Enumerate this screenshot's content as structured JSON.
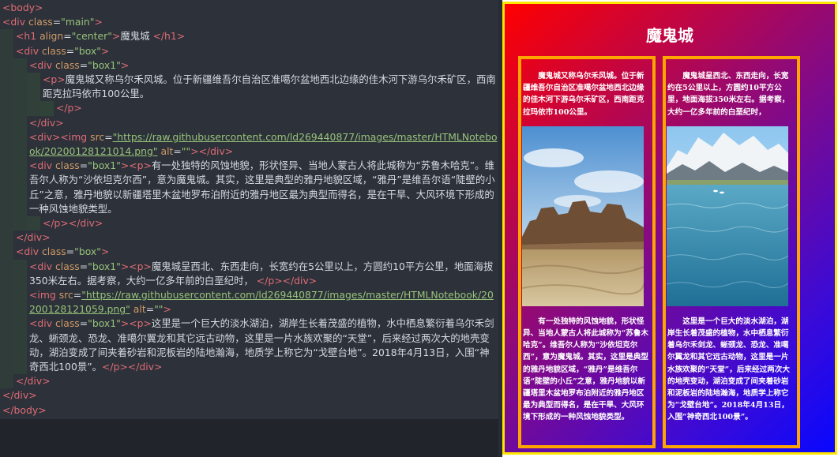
{
  "editor": {
    "lines": [
      {
        "i": 0,
        "p": [
          [
            "tk",
            "<body>"
          ]
        ]
      },
      {
        "i": 0,
        "p": [
          [
            "tk",
            "<div "
          ],
          [
            "at",
            "class"
          ],
          [
            "tx",
            "="
          ],
          [
            "sv",
            "\"main\""
          ],
          [
            "tk",
            ">"
          ]
        ]
      },
      {
        "i": 1,
        "p": [
          [
            "tk",
            "<h1 "
          ],
          [
            "at",
            "align"
          ],
          [
            "tx",
            "="
          ],
          [
            "sv",
            "\"center\""
          ],
          [
            "tk",
            ">"
          ],
          [
            "tx",
            "魔鬼城 "
          ],
          [
            "tk",
            "</h1>"
          ]
        ]
      },
      {
        "i": 1,
        "p": [
          [
            "tk",
            "<div "
          ],
          [
            "at",
            "class"
          ],
          [
            "tx",
            "="
          ],
          [
            "sv",
            "\"box\""
          ],
          [
            "tk",
            ">"
          ]
        ]
      },
      {
        "i": 2,
        "p": [
          [
            "tk",
            "<div "
          ],
          [
            "at",
            "class"
          ],
          [
            "tx",
            "="
          ],
          [
            "sv",
            "\"box1\""
          ],
          [
            "tk",
            ">"
          ]
        ]
      },
      {
        "i": 3,
        "p": [
          [
            "tk",
            "<p>"
          ],
          [
            "tx",
            "魔鬼城又称乌尔禾风城。位于新疆维吾尔自治区准噶尔盆地西北边缘的佳木河下游乌尔禾矿区，西南距克拉玛依市100公里。"
          ]
        ]
      },
      {
        "i": 4,
        "p": [
          [
            "tk",
            "</p>"
          ]
        ]
      },
      {
        "i": 2,
        "p": [
          [
            "tk",
            "</div>"
          ]
        ]
      },
      {
        "i": 2,
        "p": [
          [
            "tk",
            "<div>"
          ],
          [
            "tk",
            "<img "
          ],
          [
            "at",
            "src"
          ],
          [
            "tx",
            "="
          ],
          [
            "lk",
            "\"https://raw.githubusercontent.com/ld269440877/images/master/HTMLNotebook/20200128121014.png\""
          ],
          [
            "tx",
            " "
          ],
          [
            "at",
            "alt"
          ],
          [
            "tx",
            "="
          ],
          [
            "sv",
            "\"\""
          ],
          [
            "tk",
            ">"
          ],
          [
            "tk",
            "</div>"
          ]
        ]
      },
      {
        "i": 2,
        "p": [
          [
            "tk",
            "<div "
          ],
          [
            "at",
            "class"
          ],
          [
            "tx",
            "="
          ],
          [
            "sv",
            "\"box1\""
          ],
          [
            "tk",
            ">"
          ],
          [
            "tk",
            "<p>"
          ],
          [
            "tx",
            "有一处独特的风蚀地貌，形状怪异、当地人蒙古人将此城称为“苏鲁木哈克”。维吾尔人称为“沙依坦克尔西”，意为魔鬼城。其实，这里是典型的雅丹地貌区域，“雅丹”是维吾尔语“陡壁的小丘”之意，雅丹地貌以新疆塔里木盆地罗布泊附近的雅丹地区最为典型而得名，是在干旱、大风环境下形成的一种风蚀地貌类型。"
          ]
        ]
      },
      {
        "i": 3,
        "p": [
          [
            "tk",
            "</p>"
          ],
          [
            "tk",
            "</div>"
          ]
        ]
      },
      {
        "i": 1,
        "p": [
          [
            "tk",
            "</div>"
          ]
        ]
      },
      {
        "i": 1,
        "p": [
          [
            "tk",
            "<div "
          ],
          [
            "at",
            "class"
          ],
          [
            "tx",
            "="
          ],
          [
            "sv",
            "\"box\""
          ],
          [
            "tk",
            ">"
          ]
        ]
      },
      {
        "i": 2,
        "p": [
          [
            "tk",
            "<div "
          ],
          [
            "at",
            "class"
          ],
          [
            "tx",
            "="
          ],
          [
            "sv",
            "\"box1\""
          ],
          [
            "tk",
            ">"
          ],
          [
            "tk",
            "<p>"
          ],
          [
            "tx",
            "魔鬼城呈西北、东西走向，长宽约在5公里以上，方圆约10平方公里，地面海拔350米左右。据考察，大约一亿多年前的白垩纪时， "
          ],
          [
            "tk",
            "</p>"
          ],
          [
            "tk",
            "</div>"
          ]
        ]
      },
      {
        "i": 2,
        "p": [
          [
            "tk",
            "<img "
          ],
          [
            "at",
            "src"
          ],
          [
            "tx",
            "="
          ],
          [
            "lk",
            "\"https://raw.githubusercontent.com/ld269440877/images/master/HTMLNotebook/20200128121059.png\""
          ],
          [
            "tx",
            " "
          ],
          [
            "at",
            "alt"
          ],
          [
            "tx",
            "="
          ],
          [
            "sv",
            "\"\""
          ],
          [
            "tk",
            ">"
          ]
        ]
      },
      {
        "i": 2,
        "p": [
          [
            "tk",
            "<div "
          ],
          [
            "at",
            "class"
          ],
          [
            "tx",
            "="
          ],
          [
            "sv",
            "\"box1\""
          ],
          [
            "tk",
            ">"
          ],
          [
            "tk",
            "<p>"
          ],
          [
            "tx",
            "这里是一个巨大的淡水湖泊，湖岸生长着茂盛的植物，水中栖息繁衍着乌尔禾剑龙、蜥颈龙、恐龙、准噶尔翼龙和其它远古动物，这里是一片水族欢聚的“天堂”，后来经过两次大的地壳变动，湖泊变成了间夹着砂岩和泥板岩的陆地瀚海，地质学上称它为“戈壁台地”。2018年4月13日，入围“神奇西北100景”。"
          ],
          [
            "tk",
            "</p>"
          ],
          [
            "tk",
            "</div>"
          ]
        ]
      },
      {
        "i": 1,
        "p": [
          [
            "tk",
            "</div>"
          ]
        ]
      },
      {
        "i": 0,
        "p": [
          [
            "tk",
            "</div>"
          ]
        ]
      },
      {
        "i": 0,
        "p": [
          [
            "tk",
            "</body>"
          ]
        ]
      }
    ]
  },
  "preview": {
    "title": "魔鬼城",
    "left_box": {
      "p1": "魔鬼城又称乌尔禾风城。位于新疆维吾尔自治区准噶尔盆地西北边缘的佳木河下游乌尔禾矿区，西南距克拉玛依市100公里。",
      "p2": "有一处独特的风蚀地貌，形状怪异、当地人蒙古人将此城称为“苏鲁木哈克”。维吾尔人称为“沙依坦克尔西”，意为魔鬼城。其实，这里是典型的雅丹地貌区域，“雅丹”是维吾尔语“陡壁的小丘”之意，雅丹地貌以新疆塔里木盆地罗布泊附近的雅丹地区最为典型而得名，是在干旱、大风环境下形成的一种风蚀地貌类型。"
    },
    "right_box": {
      "p1": "魔鬼城呈西北、东西走向，长宽约在5公里以上，方圆约10平方公里，地面海拔350米左右。据考察，大约一亿多年前的白垩纪时，",
      "p2": "这里是一个巨大的淡水湖泊，湖岸生长着茂盛的植物，水中栖息繁衍着乌尔禾剑龙、蜥颈龙、恐龙、准噶尔翼龙和其它远古动物，这里是一片水族欢聚的“天堂”，后来经过两次大的地壳变动，湖泊变成了间夹着砂岩和泥板岩的陆地瀚海，地质学上称它为“戈壁台地”。2018年4月13日，入围“神奇西北100景”。"
    },
    "colors": {
      "gradient_start": "#ff0000",
      "gradient_end": "#0808ff",
      "frame": "#ffe600",
      "box_border": "#ffa500"
    }
  }
}
